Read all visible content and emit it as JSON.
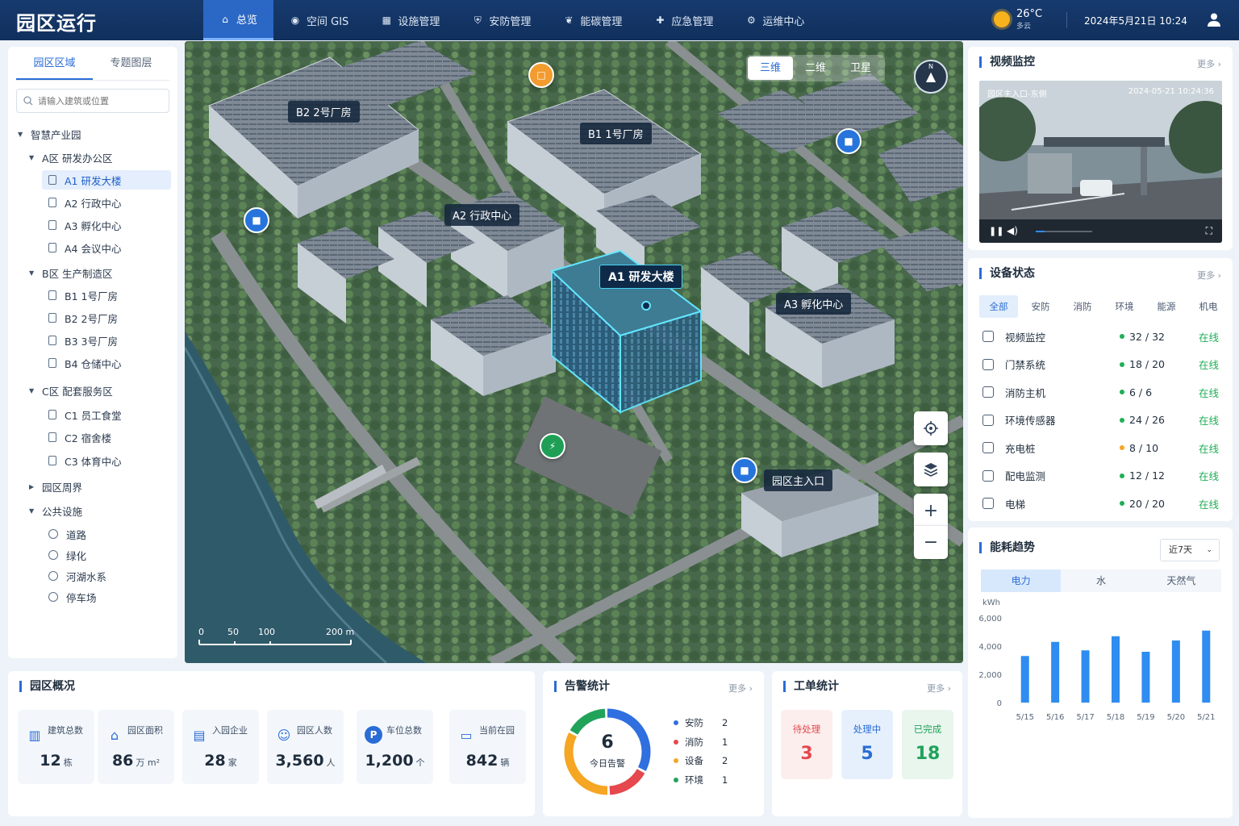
{
  "app_title": "园区运行",
  "nav": [
    {
      "label": "总览",
      "icon": "home-icon"
    },
    {
      "label": "空间 GIS",
      "icon": "location-pin-icon"
    },
    {
      "label": "设施管理",
      "icon": "grid-icon"
    },
    {
      "label": "安防管理",
      "icon": "shield-icon"
    },
    {
      "label": "能碳管理",
      "icon": "leaf-icon"
    },
    {
      "label": "应急管理",
      "icon": "first-aid-icon"
    },
    {
      "label": "运维中心",
      "icon": "gear-icon"
    }
  ],
  "weather": {
    "temp": "26°C",
    "desc": "多云"
  },
  "datetime": "2024年5月21日  10:24",
  "sidebar": {
    "tabs": [
      "园区区域",
      "专题图层"
    ],
    "search_placeholder": "请输入建筑或位置",
    "tree": [
      {
        "label": "智慧产业园",
        "level": 0,
        "caret": "▼"
      },
      {
        "label": "A区  研发办公区",
        "level": 1,
        "caret": "▼"
      },
      {
        "label": "A1 研发大楼",
        "level": 2,
        "selected": true
      },
      {
        "label": "A2 行政中心",
        "level": 2
      },
      {
        "label": "A3 孵化中心",
        "level": 2
      },
      {
        "label": "A4 会议中心",
        "level": 2
      },
      {
        "label": "B区  生产制造区",
        "level": 1,
        "caret": "▼"
      },
      {
        "label": "B1  1号厂房",
        "level": 2
      },
      {
        "label": "B2  2号厂房",
        "level": 2
      },
      {
        "label": "B3  3号厂房",
        "level": 2
      },
      {
        "label": "B4  仓储中心",
        "level": 2
      },
      {
        "label": "C区  配套服务区",
        "level": 1,
        "caret": "▼"
      },
      {
        "label": "C1  员工食堂",
        "level": 2
      },
      {
        "label": "C2  宿舍楼",
        "level": 2
      },
      {
        "label": "C3  体育中心",
        "level": 2
      },
      {
        "label": "园区周界",
        "level": 1,
        "caret": "▶"
      },
      {
        "label": "公共设施",
        "level": 1,
        "caret": "▼"
      },
      {
        "label": "道路",
        "level": 3
      },
      {
        "label": "绿化",
        "level": 3
      },
      {
        "label": "河湖水系",
        "level": 3
      },
      {
        "label": "停车场",
        "level": 3
      }
    ]
  },
  "map": {
    "view_modes": [
      "三维",
      "二维",
      "卫星"
    ],
    "active_view": "三维",
    "compass": "N",
    "labels": [
      "B2  2号厂房",
      "B1  1号厂房",
      "A2  行政中心",
      "A1  研发大楼",
      "A3  孵化中心",
      "园区主入口"
    ],
    "scale": [
      "0",
      "50",
      "100",
      "200 m"
    ]
  },
  "video": {
    "title": "视频监控",
    "more": "更多 ›",
    "camera": "园区主入口-东侧",
    "timestamp": "2024-05-21 10:24:36",
    "progress": 0.15
  },
  "devices": {
    "title": "设备状态",
    "more": "更多 ›",
    "tabs": [
      "全部",
      "安防",
      "消防",
      "环境",
      "能源",
      "机电"
    ],
    "rows": [
      {
        "name": "视频监控",
        "count": "32 / 32",
        "status": "在线",
        "dot": "#1fae55"
      },
      {
        "name": "门禁系统",
        "count": "18 / 20",
        "status": "在线",
        "dot": "#1fae55"
      },
      {
        "name": "消防主机",
        "count": "6 / 6",
        "status": "在线",
        "dot": "#1fae55"
      },
      {
        "name": "环境传感器",
        "count": "24 / 26",
        "status": "在线",
        "dot": "#1fae55"
      },
      {
        "name": "充电桩",
        "count": "8 / 10",
        "status": "在线",
        "dot": "#f5a623"
      },
      {
        "name": "配电监测",
        "count": "12 / 12",
        "status": "在线",
        "dot": "#1fae55"
      },
      {
        "name": "电梯",
        "count": "20 / 20",
        "status": "在线",
        "dot": "#1fae55"
      }
    ]
  },
  "energy": {
    "title": "能耗趋势",
    "range": "近7天",
    "tabs": [
      "电力",
      "水",
      "天然气"
    ]
  },
  "chart_data": {
    "type": "bar",
    "ylabel": "kWh",
    "categories": [
      "5/15",
      "5/16",
      "5/17",
      "5/18",
      "5/19",
      "5/20",
      "5/21"
    ],
    "values": [
      3300,
      4300,
      3700,
      4700,
      3600,
      4400,
      5100
    ],
    "ylim": [
      0,
      6000
    ],
    "yticks": [
      "6,000",
      "4,000",
      "2,000",
      "0"
    ],
    "color": "#2f8cf0"
  },
  "overview": {
    "title": "园区概况",
    "stats": [
      {
        "label": "建筑总数",
        "value": "12",
        "unit": "栋",
        "icon": "building-icon"
      },
      {
        "label": "园区面积",
        "value": "86",
        "unit": "万 m²",
        "icon": "park-area-icon"
      },
      {
        "label": "入园企业",
        "value": "28",
        "unit": "家",
        "icon": "company-icon"
      },
      {
        "label": "园区人数",
        "value": "3,560",
        "unit": "人",
        "icon": "people-icon"
      },
      {
        "label": "车位总数",
        "value": "1,200",
        "unit": "个",
        "icon": "parking-icon"
      },
      {
        "label": "当前在园",
        "value": "842",
        "unit": "辆",
        "icon": "car-icon"
      }
    ]
  },
  "alarms": {
    "title": "告警统计",
    "more": "更多 ›",
    "total": "6",
    "total_label": "今日告警",
    "items": [
      {
        "label": "安防",
        "value": 2,
        "color": "#2f6fe0"
      },
      {
        "label": "消防",
        "value": 1,
        "color": "#e5484d"
      },
      {
        "label": "设备",
        "value": 2,
        "color": "#f5a623"
      },
      {
        "label": "环境",
        "value": 1,
        "color": "#21a35a"
      }
    ]
  },
  "workorders": {
    "title": "工单统计",
    "more": "更多 ›",
    "items": [
      {
        "label": "待处理",
        "value": "3",
        "color": "#e5484d",
        "bg": "#fdeeee"
      },
      {
        "label": "处理中",
        "value": "5",
        "color": "#2a6cd6",
        "bg": "#e6f0fd"
      },
      {
        "label": "已完成",
        "value": "18",
        "color": "#1fa358",
        "bg": "#e8f6ee"
      }
    ]
  }
}
